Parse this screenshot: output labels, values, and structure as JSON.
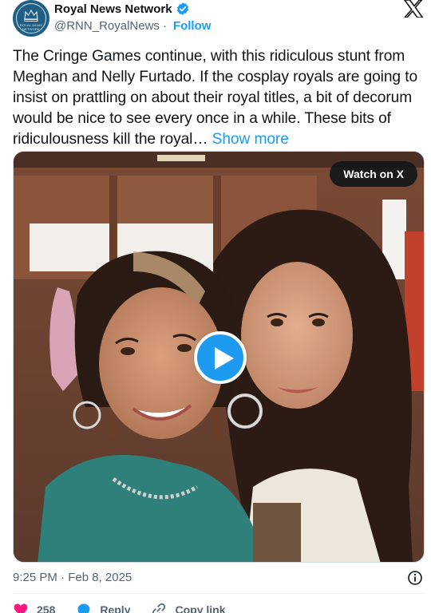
{
  "account": {
    "display_name": "Royal News Network",
    "handle": "@RNN_RoyalNews",
    "separator": "·",
    "follow_label": "Follow",
    "avatar_text": "ROYAL NEWS NETWORK",
    "verified_color": "#1d9bf0"
  },
  "tweet": {
    "text": "The Cringe Games continue, with this ridiculous stunt from Meghan and Nelly Furtado. If the cosplay royals are going to insist on prattling on about their royal titles, a bit of decorum would be nice to see every once in a while. These bits of ridiculousness kill the royal…",
    "show_more_label": "Show more"
  },
  "media": {
    "watch_label": "Watch on X",
    "play_icon": "play-icon"
  },
  "meta": {
    "timestamp": "9:25 PM · Feb 8, 2025"
  },
  "actions": {
    "likes_count": "258",
    "reply_label": "Reply",
    "copy_link_label": "Copy link"
  },
  "colors": {
    "accent": "#1d9bf0",
    "like": "#f91880",
    "text": "#0f1419",
    "muted": "#536471"
  }
}
